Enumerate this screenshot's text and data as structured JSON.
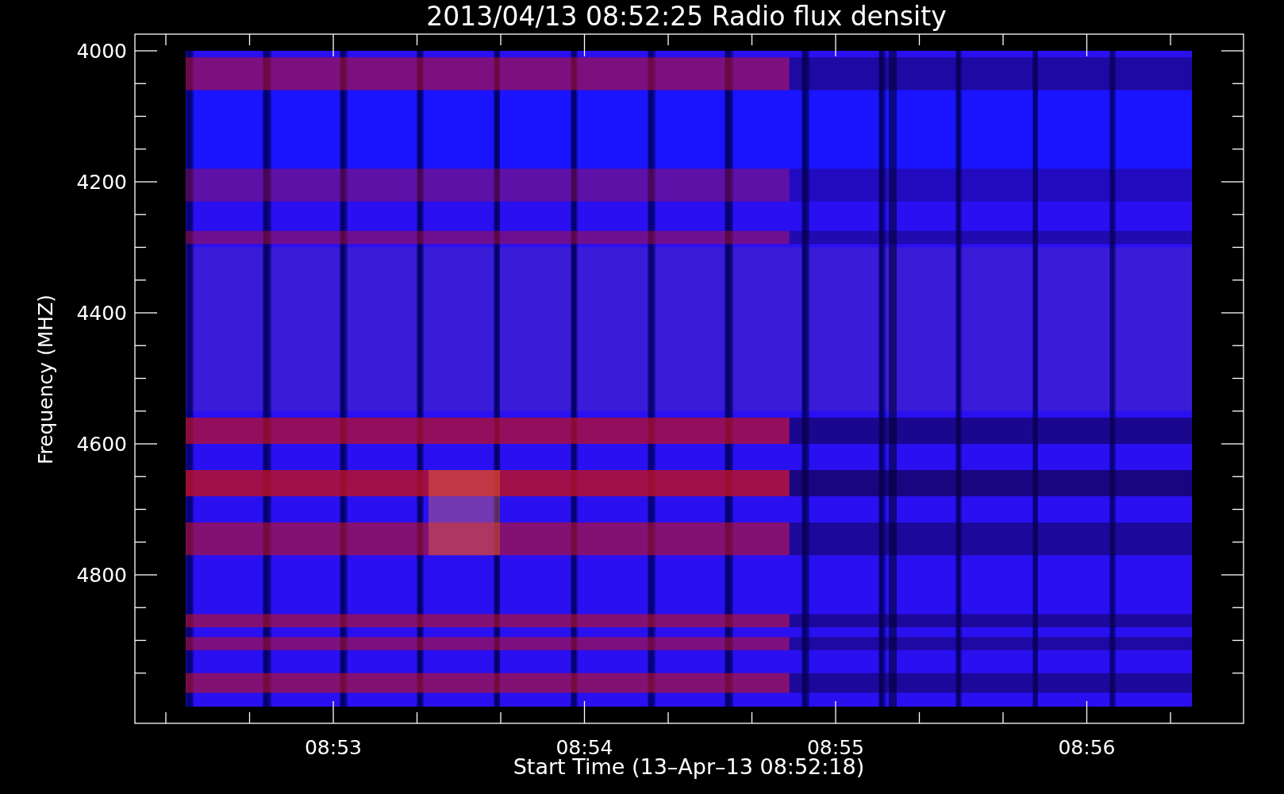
{
  "plot": {
    "title": "2013/04/13 08:52:25 Radio flux density",
    "ylabel": "Frequency (MHZ)",
    "xlabel": "Start Time (13–Apr–13 08:52:18)",
    "yticks": [
      "4000",
      "4200",
      "4400",
      "4600",
      "4800"
    ],
    "xticks": [
      "08:53",
      "08:54",
      "08:55",
      "08:56"
    ]
  }
}
